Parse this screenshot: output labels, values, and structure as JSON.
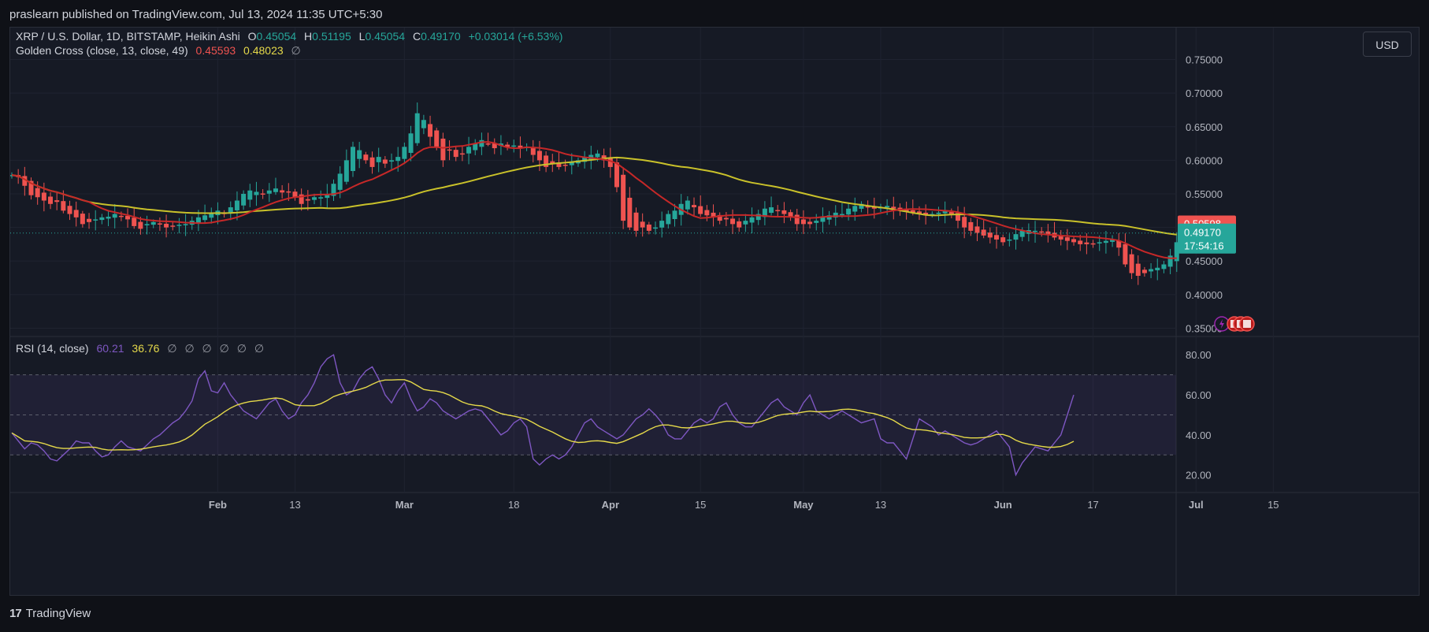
{
  "publisher_line": "praslearn published on TradingView.com, Jul 13, 2024 11:35 UTC+5:30",
  "currency_button": "USD",
  "footer": {
    "logo_glyph": "17",
    "brand": "TradingView"
  },
  "legend": {
    "symbol": "XRP / U.S. Dollar, 1D, BITSTAMP, Heikin Ashi",
    "open_label": "O",
    "open": "0.45054",
    "high_label": "H",
    "high": "0.51195",
    "low_label": "L",
    "low": "0.45054",
    "close_label": "C",
    "close": "0.49170",
    "change": "+0.03014 (+6.53%)",
    "indicator": "Golden Cross (close, 13, close, 49)",
    "ma_fast": "0.45593",
    "ma_slow": "0.48023",
    "settings_glyph": "∅"
  },
  "rsi_legend": {
    "name": "RSI (14, close)",
    "rsi": "60.21",
    "rsi_ma": "36.76",
    "glyphs": [
      "∅",
      "∅",
      "∅",
      "∅",
      "∅",
      "∅"
    ]
  },
  "price_badges": {
    "upper": "0.50598",
    "current": "0.49170",
    "countdown": "17:54:16"
  },
  "colors": {
    "up": "#26a69a",
    "down": "#ef5350",
    "ma_fast": "#c62828",
    "ma_slow": "#c9c12a",
    "rsi": "#7e57c2",
    "rsi_ma": "#e5d94a",
    "badge_upper": "#ef5350",
    "badge_current": "#26a69a"
  },
  "chart_data": {
    "type": "candlestick",
    "symbol": "XRP / U.S. Dollar",
    "interval": "1D",
    "price_axis": {
      "ticks": [
        0.35,
        0.4,
        0.45,
        0.5,
        0.55,
        0.6,
        0.65,
        0.7,
        0.75
      ],
      "tick_labels": [
        "0.35000",
        "0.40000",
        "0.45000",
        "0.50000",
        "0.55000",
        "0.60000",
        "0.65000",
        "0.70000",
        "0.75000"
      ],
      "range": [
        0.34,
        0.76
      ]
    },
    "rsi_axis": {
      "ticks": [
        20,
        40,
        60,
        80
      ],
      "tick_labels": [
        "20.00",
        "40.00",
        "60.00",
        "80.00"
      ],
      "range": [
        12,
        86
      ],
      "bands": [
        30,
        50,
        70
      ]
    },
    "time_axis": {
      "labels": [
        "Feb",
        "13",
        "Mar",
        "18",
        "Apr",
        "15",
        "May",
        "13",
        "Jun",
        "17",
        "Jul",
        "15"
      ],
      "day_index": [
        32,
        44,
        61,
        78,
        93,
        107,
        123,
        135,
        154,
        168,
        184,
        196
      ]
    },
    "closes": [
      0.578,
      0.575,
      0.562,
      0.548,
      0.545,
      0.54,
      0.535,
      0.538,
      0.525,
      0.52,
      0.515,
      0.505,
      0.508,
      0.512,
      0.515,
      0.516,
      0.52,
      0.517,
      0.512,
      0.502,
      0.498,
      0.505,
      0.508,
      0.505,
      0.5,
      0.502,
      0.504,
      0.505,
      0.51,
      0.515,
      0.518,
      0.522,
      0.525,
      0.52,
      0.53,
      0.54,
      0.55,
      0.555,
      0.553,
      0.55,
      0.555,
      0.558,
      0.552,
      0.553,
      0.545,
      0.535,
      0.54,
      0.545,
      0.545,
      0.55,
      0.565,
      0.58,
      0.6,
      0.62,
      0.615,
      0.6,
      0.59,
      0.605,
      0.595,
      0.6,
      0.605,
      0.62,
      0.64,
      0.67,
      0.66,
      0.635,
      0.62,
      0.6,
      0.615,
      0.605,
      0.61,
      0.62,
      0.625,
      0.63,
      0.625,
      0.618,
      0.625,
      0.62,
      0.622,
      0.618,
      0.62,
      0.608,
      0.6,
      0.59,
      0.595,
      0.59,
      0.592,
      0.598,
      0.6,
      0.605,
      0.608,
      0.61,
      0.6,
      0.59,
      0.56,
      0.51,
      0.5,
      0.495,
      0.5,
      0.495,
      0.5,
      0.51,
      0.52,
      0.525,
      0.535,
      0.54,
      0.53,
      0.52,
      0.518,
      0.515,
      0.51,
      0.512,
      0.505,
      0.5,
      0.51,
      0.515,
      0.52,
      0.528,
      0.53,
      0.525,
      0.52,
      0.515,
      0.505,
      0.505,
      0.505,
      0.51,
      0.515,
      0.518,
      0.522,
      0.52,
      0.528,
      0.532,
      0.535,
      0.53,
      0.528,
      0.53,
      0.532,
      0.528,
      0.525,
      0.524,
      0.522,
      0.52,
      0.518,
      0.52,
      0.522,
      0.525,
      0.52,
      0.51,
      0.5,
      0.495,
      0.492,
      0.488,
      0.485,
      0.482,
      0.478,
      0.482,
      0.49,
      0.495,
      0.496,
      0.495,
      0.494,
      0.49,
      0.485,
      0.482,
      0.48,
      0.478,
      0.475,
      0.475,
      0.476,
      0.478,
      0.48,
      0.482,
      0.47,
      0.445,
      0.432,
      0.428,
      0.432,
      0.438,
      0.44,
      0.445,
      0.458,
      0.478
    ],
    "ma_fast_last": 0.45593,
    "ma_slow_last": 0.48023,
    "last_close": 0.4917,
    "rsi_last": 60.21,
    "rsi_ma_last": 36.76,
    "rsi_values": [
      41,
      37,
      33,
      36,
      35,
      32,
      28,
      27,
      30,
      33,
      37,
      36,
      36,
      32,
      29,
      30,
      34,
      37,
      34,
      33,
      32,
      35,
      38,
      40,
      43,
      46,
      48,
      52,
      57,
      68,
      72,
      62,
      61,
      66,
      60,
      56,
      52,
      50,
      48,
      52,
      56,
      58,
      52,
      48,
      50,
      56,
      60,
      66,
      74,
      78,
      80,
      66,
      60,
      62,
      68,
      72,
      74,
      68,
      60,
      56,
      62,
      66,
      58,
      52,
      54,
      58,
      56,
      52,
      50,
      48,
      50,
      52,
      53,
      52,
      48,
      44,
      40,
      42,
      46,
      48,
      44,
      28,
      25,
      28,
      30,
      28,
      30,
      34,
      40,
      46,
      48,
      44,
      42,
      40,
      38,
      40,
      44,
      48,
      50,
      53,
      50,
      46,
      40,
      38,
      38,
      42,
      46,
      48,
      46,
      48,
      54,
      56,
      50,
      46,
      44,
      44,
      48,
      52,
      56,
      58,
      54,
      52,
      50,
      56,
      60,
      52,
      50,
      48,
      50,
      52,
      50,
      48,
      46,
      47,
      48,
      38,
      36,
      36,
      32,
      28,
      38,
      48,
      46,
      44,
      40,
      42,
      40,
      38,
      36,
      35,
      36,
      38,
      40,
      42,
      38,
      34,
      20,
      26,
      30,
      34,
      33,
      32,
      36,
      40,
      50,
      60
    ]
  }
}
